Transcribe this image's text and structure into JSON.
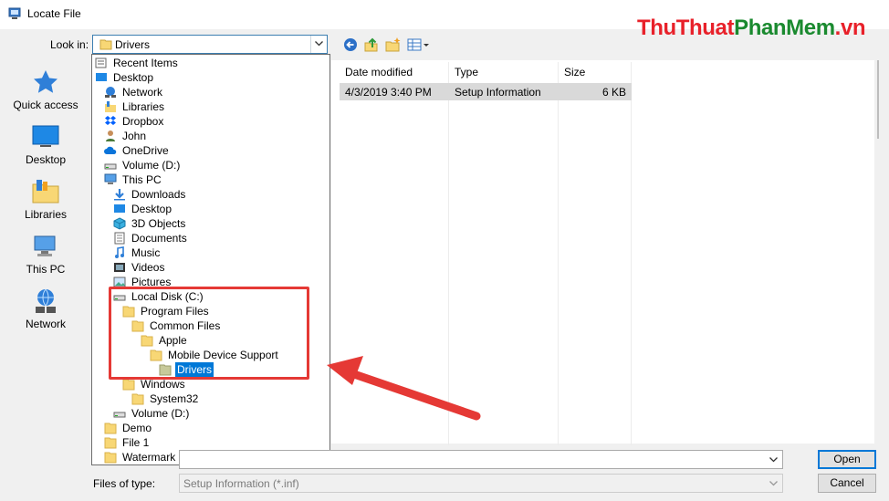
{
  "window": {
    "title": "Locate File"
  },
  "watermark": {
    "part1": "ThuThuat",
    "part2": "PhanMem",
    "part3": ".vn"
  },
  "lookin": {
    "label": "Look in:",
    "value": "Drivers"
  },
  "places": [
    {
      "label": "Quick access",
      "icon": "star-icon"
    },
    {
      "label": "Desktop",
      "icon": "desktop-icon"
    },
    {
      "label": "Libraries",
      "icon": "libraries-icon"
    },
    {
      "label": "This PC",
      "icon": "computer-icon"
    },
    {
      "label": "Network",
      "icon": "network-icon"
    }
  ],
  "columns": {
    "date": "Date modified",
    "type": "Type",
    "size": "Size"
  },
  "file": {
    "date": "4/3/2019 3:40 PM",
    "type": "Setup Information",
    "size": "6 KB"
  },
  "dropdown": [
    {
      "label": "Recent Items",
      "icon": "recent-items-icon"
    },
    {
      "label": "Desktop",
      "icon": "desktop-icon"
    },
    {
      "label": "Network",
      "icon": "network-icon"
    },
    {
      "label": "Libraries",
      "icon": "libraries-icon"
    },
    {
      "label": "Dropbox",
      "icon": "dropbox-icon"
    },
    {
      "label": "John",
      "icon": "user-icon"
    },
    {
      "label": "OneDrive",
      "icon": "cloud-icon"
    },
    {
      "label": "Volume (D:)",
      "icon": "drive-icon"
    },
    {
      "label": "This PC",
      "icon": "computer-icon"
    },
    {
      "label": "Downloads",
      "icon": "download-icon"
    },
    {
      "label": "Desktop",
      "icon": "desktop-icon"
    },
    {
      "label": "3D Objects",
      "icon": "cube-icon"
    },
    {
      "label": "Documents",
      "icon": "document-icon"
    },
    {
      "label": "Music",
      "icon": "music-icon"
    },
    {
      "label": "Videos",
      "icon": "video-icon"
    },
    {
      "label": "Pictures",
      "icon": "picture-icon"
    },
    {
      "label": "Local Disk (C:)",
      "icon": "drive-icon"
    },
    {
      "label": "Program Files",
      "icon": "folder-icon"
    },
    {
      "label": "Common Files",
      "icon": "folder-icon"
    },
    {
      "label": "Apple",
      "icon": "folder-icon"
    },
    {
      "label": "Mobile Device Support",
      "icon": "folder-icon"
    },
    {
      "label": "Drivers",
      "icon": "folder-open-icon"
    },
    {
      "label": "Windows",
      "icon": "folder-icon"
    },
    {
      "label": "System32",
      "icon": "folder-icon"
    },
    {
      "label": "Volume (D:)",
      "icon": "drive-icon"
    },
    {
      "label": "Demo",
      "icon": "folder-icon"
    },
    {
      "label": "File 1",
      "icon": "folder-icon"
    },
    {
      "label": "Watermark",
      "icon": "folder-icon"
    }
  ],
  "types": {
    "label": "Files of type:",
    "value": "Setup Information (*.inf)"
  },
  "buttons": {
    "open": "Open",
    "cancel": "Cancel"
  },
  "colors": {
    "accent": "#0078d7",
    "highlight": "#e53935",
    "folder": "#f8d775"
  }
}
